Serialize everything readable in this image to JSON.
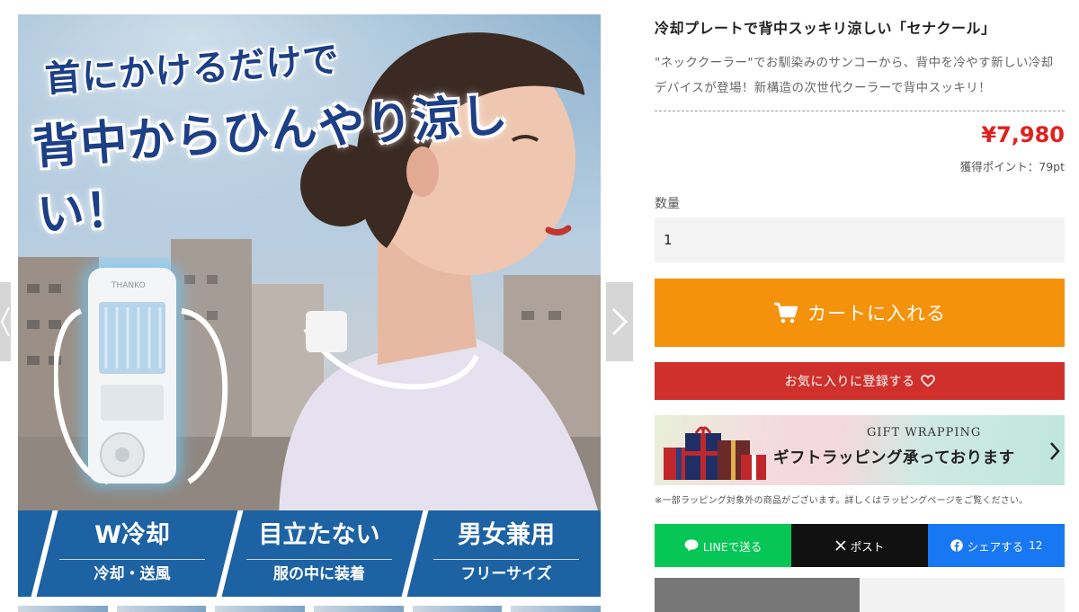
{
  "gallery": {
    "headline_line1": "首にかけるだけで",
    "headline_line2": "背中からひんやり涼しい！",
    "device_brand": "THANKO",
    "features": [
      {
        "title": "W冷却",
        "sub": "冷却・送風"
      },
      {
        "title": "目立たない",
        "sub": "服の中に装着"
      },
      {
        "title": "男女兼用",
        "sub": "フリーサイズ"
      }
    ],
    "prev_icon": "chevron-left-icon",
    "next_icon": "chevron-right-icon"
  },
  "product": {
    "title": "冷却プレートで背中スッキリ涼しい「セナクール」",
    "description": "\"ネッククーラー\"でお馴染みのサンコーから、背中を冷やす新しい冷却デバイスが登場！新構造の次世代クーラーで背中スッキリ！",
    "price": "¥7,980",
    "points": "獲得ポイント：79pt"
  },
  "purchase": {
    "quantity_label": "数量",
    "quantity_value": "1",
    "cart_label": "カートに入れる",
    "favorite_label": "お気に入りに登録する"
  },
  "gift": {
    "title_en": "GIFT WRAPPING",
    "title_ja": "ギフトラッピング承っております",
    "note": "※一部ラッピング対象外の商品がございます。詳しくはラッピングページをご覧ください。"
  },
  "share": {
    "line_label": "LINEで送る",
    "x_label": "ポスト",
    "facebook_label": "シェアする",
    "facebook_count": "12"
  },
  "colors": {
    "cart": "#f5920b",
    "favorite": "#d0302b",
    "price": "#e0211e",
    "line": "#06c755",
    "x": "#111111",
    "facebook": "#1877f2",
    "feature_band": "#1d62a3",
    "headline": "#1d3f86"
  }
}
